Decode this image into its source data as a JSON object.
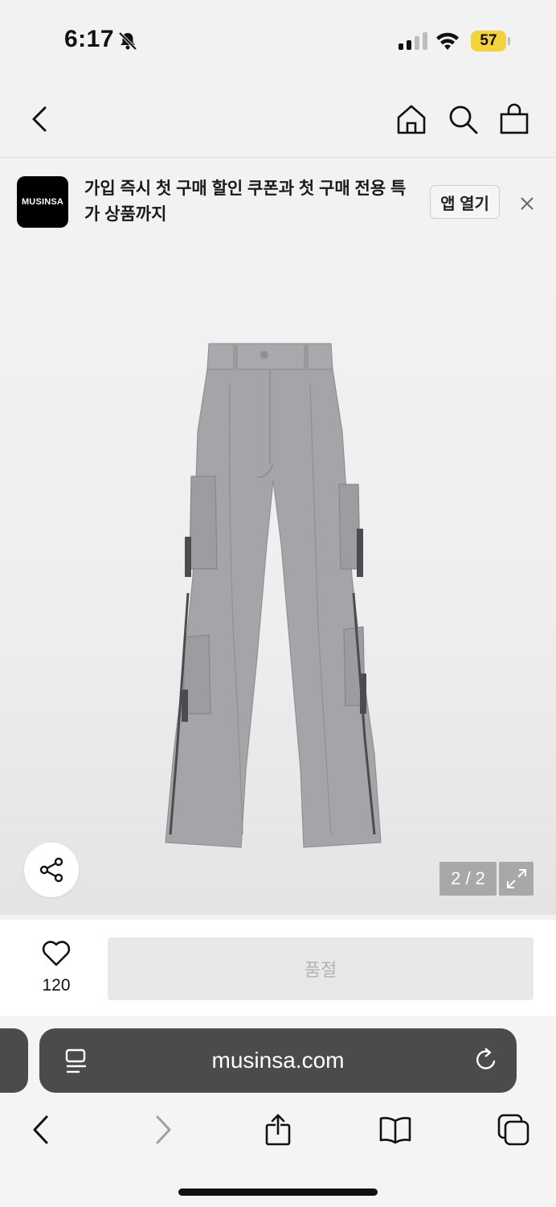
{
  "status_bar": {
    "time": "6:17",
    "battery": "57",
    "icons": [
      "bell-slash-icon",
      "cellular-signal-icon",
      "wifi-icon",
      "battery-icon"
    ]
  },
  "nav": {
    "icons": [
      "back-chevron-icon",
      "home-icon",
      "search-icon",
      "shopping-bag-icon"
    ]
  },
  "banner": {
    "logo_text": "MUSINSA",
    "message": "가입 즉시 첫 구매 할인 쿠폰과 첫 구매 전용 특가 상품까지",
    "open_app_label": "앱 열기",
    "close_icon": "close-icon"
  },
  "gallery": {
    "image_index": "2 / 2",
    "share_icon": "share-icon",
    "expand_icon": "expand-icon",
    "colors": {
      "pants": "#a3a5a8",
      "pants_shadow": "#8e9094",
      "pants_dark": "#4a4c50"
    }
  },
  "action_bar": {
    "like_icon": "heart-icon",
    "like_count": "120",
    "soldout_label": "품절"
  },
  "safari": {
    "url": "musinsa.com",
    "icons": [
      "reader-icon",
      "reload-icon",
      "back-icon",
      "forward-icon",
      "share-icon",
      "bookmarks-icon",
      "tabs-icon"
    ]
  }
}
